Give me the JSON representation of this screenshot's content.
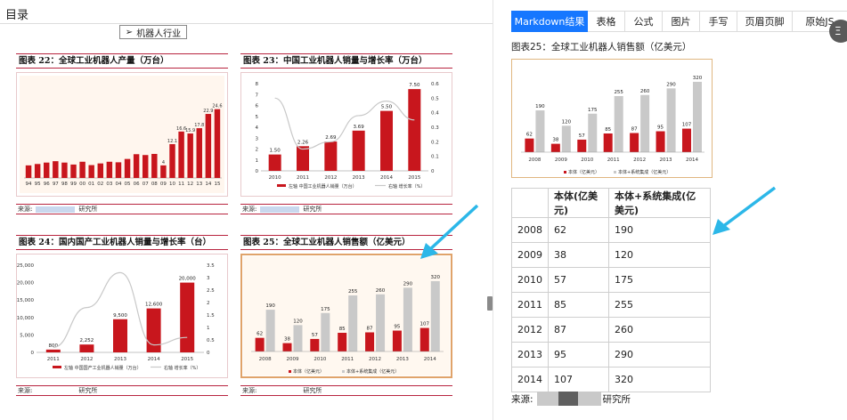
{
  "left": {
    "title": "目录",
    "industry_label": "机器人行业",
    "source_label": "来源:",
    "source_suffix": "研究所"
  },
  "right": {
    "tabs": [
      "Markdown结果",
      "表格",
      "公式",
      "图片",
      "手写",
      "页眉页脚",
      "原始JS"
    ],
    "caption": "图表25：全球工业机器人销售额（亿美元）",
    "table": {
      "headers": [
        "",
        "本体(亿美元)",
        "本体+系统集成(亿美元)"
      ],
      "rows": [
        [
          "2008",
          "62",
          "190"
        ],
        [
          "2009",
          "38",
          "120"
        ],
        [
          "2010",
          "57",
          "175"
        ],
        [
          "2011",
          "85",
          "255"
        ],
        [
          "2012",
          "87",
          "260"
        ],
        [
          "2013",
          "95",
          "290"
        ],
        [
          "2014",
          "107",
          "320"
        ]
      ]
    },
    "source_label": "来源:",
    "source_suffix": "研究所",
    "side_button_glyph": "Ξ"
  },
  "colors": {
    "red": "#c8161d",
    "gray": "#c9c9c9",
    "accent": "#1677ff",
    "arrow": "#2cb7e8",
    "rule": "#b8243f"
  },
  "chart_data": [
    {
      "id": "fig22",
      "title": "图表 22：全球工业机器人产量（万台）",
      "type": "bar",
      "categories": [
        "94",
        "95",
        "96",
        "97",
        "98",
        "99",
        "00",
        "01",
        "02",
        "03",
        "04",
        "05",
        "06",
        "07",
        "08",
        "09",
        "10",
        "11",
        "12",
        "13",
        "14",
        "15"
      ],
      "values": [
        4.5,
        5,
        5.5,
        6,
        5.5,
        4.8,
        5.8,
        4.6,
        5.2,
        5.8,
        5.6,
        6.8,
        8.5,
        8.2,
        8.6,
        4.5,
        12.1,
        16.6,
        15.9,
        17.8,
        22.9,
        24.6
      ],
      "data_labels": {
        "15": "4",
        "16": "12.1",
        "17": "16.6",
        "18": "15.9",
        "19": "17.8",
        "20": "22.9",
        "21": "24.6"
      },
      "ylim": [
        0,
        28
      ]
    },
    {
      "id": "fig23",
      "title": "图表 23：中国工业机器人销量与增长率（万台）",
      "type": "bar+line",
      "categories": [
        "2010",
        "2011",
        "2012",
        "2013",
        "2014",
        "2015"
      ],
      "series": [
        {
          "name": "左轴 中国工业机器人销量（万台）",
          "values": [
            1.5,
            2.26,
            2.69,
            3.69,
            5.5,
            7.5
          ],
          "labels": [
            "1.50",
            "2.26",
            "2.69",
            "3.69",
            "5.50",
            "7.50"
          ]
        },
        {
          "name": "右轴 增长率（%）",
          "values": [
            0.5,
            0.15,
            0.2,
            0.38,
            0.48,
            0.35
          ]
        }
      ],
      "y_ticks": [
        "0",
        "1",
        "2",
        "3",
        "4",
        "5",
        "6",
        "7",
        "8"
      ],
      "y2_ticks": [
        "0",
        "0.1",
        "0.2",
        "0.3",
        "0.4",
        "0.5",
        "0.6"
      ],
      "ylim": [
        0,
        8
      ],
      "y2lim": [
        0,
        0.6
      ]
    },
    {
      "id": "fig24",
      "title": "图表 24：国内国产工业机器人销量与增长率（台）",
      "type": "bar+line",
      "categories": [
        "2011",
        "2012",
        "2013",
        "2014",
        "2015"
      ],
      "series": [
        {
          "name": "左轴 中国国产工业机器人销量（万台）",
          "values": [
            800,
            2252,
            9500,
            12600,
            20000
          ],
          "labels": [
            "800",
            "2,252",
            "9,500",
            "12,600",
            "20,000"
          ]
        },
        {
          "name": "右轴 增长率（%）",
          "values": [
            0.2,
            1.8,
            3.2,
            0.3,
            0.6
          ]
        }
      ],
      "y_ticks": [
        "0",
        "5,000",
        "10,000",
        "15,000",
        "20,000",
        "25,000"
      ],
      "y2_ticks": [
        "0",
        "0.5",
        "1",
        "1.5",
        "2",
        "2.5",
        "3",
        "3.5"
      ],
      "ylim": [
        0,
        25000
      ],
      "y2lim": [
        0,
        3.5
      ]
    },
    {
      "id": "fig25",
      "title": "图表 25：全球工业机器人销售额（亿美元）",
      "type": "bar",
      "categories": [
        "2008",
        "2009",
        "2010",
        "2011",
        "2012",
        "2013",
        "2014"
      ],
      "series": [
        {
          "name": "本体（亿美元）",
          "values": [
            62,
            38,
            57,
            85,
            87,
            95,
            107
          ]
        },
        {
          "name": "本体+系统集成（亿美元）",
          "values": [
            190,
            120,
            175,
            255,
            260,
            290,
            320
          ]
        }
      ],
      "ylim": [
        0,
        340
      ]
    }
  ]
}
